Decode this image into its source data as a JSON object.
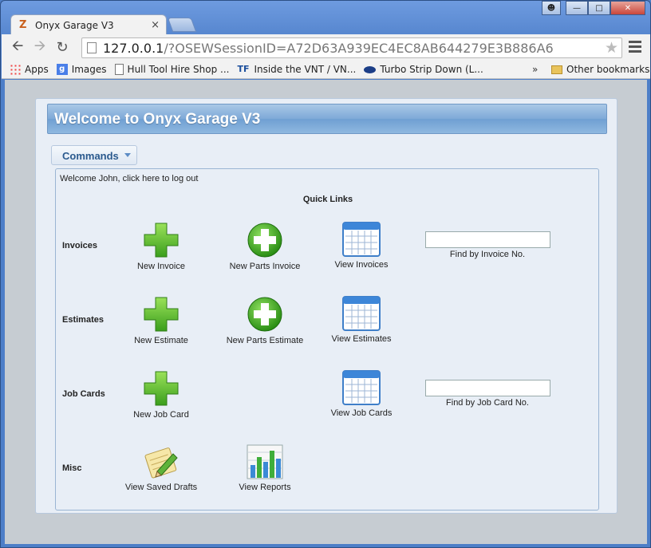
{
  "browser": {
    "tab_title": "Onyx Garage V3",
    "tab_close": "×",
    "url_host": "127.0.0.1",
    "url_path": "/?OSEWSessionID=A72D63A939EC4EC8AB644279E3B886A6",
    "bookmarks": [
      {
        "label": "Apps",
        "icon": "apps-icon"
      },
      {
        "label": "Images",
        "icon": "google-icon"
      },
      {
        "label": "Hull Tool Hire Shop ...",
        "icon": "page-icon"
      },
      {
        "label": "Inside the VNT / VN...",
        "icon": "tf-icon"
      },
      {
        "label": "Turbo Strip Down (L...",
        "icon": "ford-icon"
      }
    ],
    "bookmarks_more": "»",
    "other_bookmarks": "Other bookmarks"
  },
  "page": {
    "banner_title": "Welcome to Onyx Garage V3",
    "commands_label": "Commands",
    "welcome_text": "Welcome John, click here to log out",
    "quick_links_title": "Quick Links",
    "rows": {
      "invoices": {
        "label": "Invoices",
        "links": [
          "New Invoice",
          "New Parts Invoice",
          "View Invoices"
        ],
        "finder_label": "Find by Invoice No.",
        "finder_value": ""
      },
      "estimates": {
        "label": "Estimates",
        "links": [
          "New Estimate",
          "New Parts Estimate",
          "View Estimates"
        ]
      },
      "job_cards": {
        "label": "Job Cards",
        "links": [
          "New Job Card",
          "View Job Cards"
        ],
        "finder_label": "Find by Job Card No.",
        "finder_value": ""
      },
      "misc": {
        "label": "Misc",
        "links": [
          "View Saved Drafts",
          "View Reports"
        ]
      }
    }
  }
}
